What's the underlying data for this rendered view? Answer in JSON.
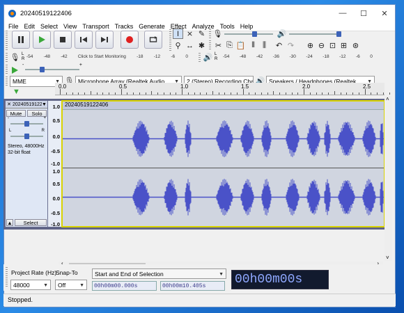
{
  "window": {
    "title": "20240519122406",
    "minimize": "—",
    "maximize": "☐",
    "close": "✕"
  },
  "menu": [
    "File",
    "Edit",
    "Select",
    "View",
    "Transport",
    "Tracks",
    "Generate",
    "Effect",
    "Analyze",
    "Tools",
    "Help"
  ],
  "transport": {
    "pause": "pause-icon",
    "play": "play-icon",
    "stop": "stop-icon",
    "skip_start": "skip-start-icon",
    "skip_end": "skip-end-icon",
    "record": "record-icon",
    "loop": "loop-icon"
  },
  "meters": {
    "rec_scale": [
      "-54",
      "-48",
      "-42",
      "Click to Start Monitoring",
      "-18",
      "-12",
      "-6",
      "0"
    ],
    "play_scale": [
      "-54",
      "-48",
      "-42",
      "-36",
      "-30",
      "-24",
      "-18",
      "-12",
      "-6",
      "0"
    ],
    "lr": [
      "L",
      "R"
    ]
  },
  "devices": {
    "host": "MME",
    "input": "Microphone Array (Realtek Audio",
    "channels": "2 (Stereo) Recording Cha",
    "output": "Speakers / Headphones (Realtek"
  },
  "ruler": {
    "labels": [
      "0.0",
      "0.5",
      "1.0",
      "1.5",
      "2.0",
      "2.5"
    ]
  },
  "track": {
    "name": "20240519122406",
    "clip_name": "20240519122406",
    "mute": "Mute",
    "solo": "Solo",
    "gain_minus": "-",
    "gain_plus": "+",
    "pan_l": "L",
    "pan_r": "R",
    "info": "Stereo, 48000Hz\n32-bit float",
    "select": "Select",
    "scale": [
      "1.0",
      "0.5",
      "0.0",
      "-0.5",
      "-1.0"
    ]
  },
  "bottom": {
    "project_rate_label": "Project Rate (Hz)",
    "project_rate": "48000",
    "snap_label": "Snap-To",
    "snap": "Off",
    "selection_label": "Start and End of Selection",
    "start_time": "00h00m00.000s",
    "end_time": "00h00m10.405s",
    "position": "00h00m00s"
  },
  "status": "Stopped.",
  "colors": {
    "wave": "#4a52c8",
    "track_bg": "#d0d5e0",
    "selected_border": "#d9d300"
  }
}
